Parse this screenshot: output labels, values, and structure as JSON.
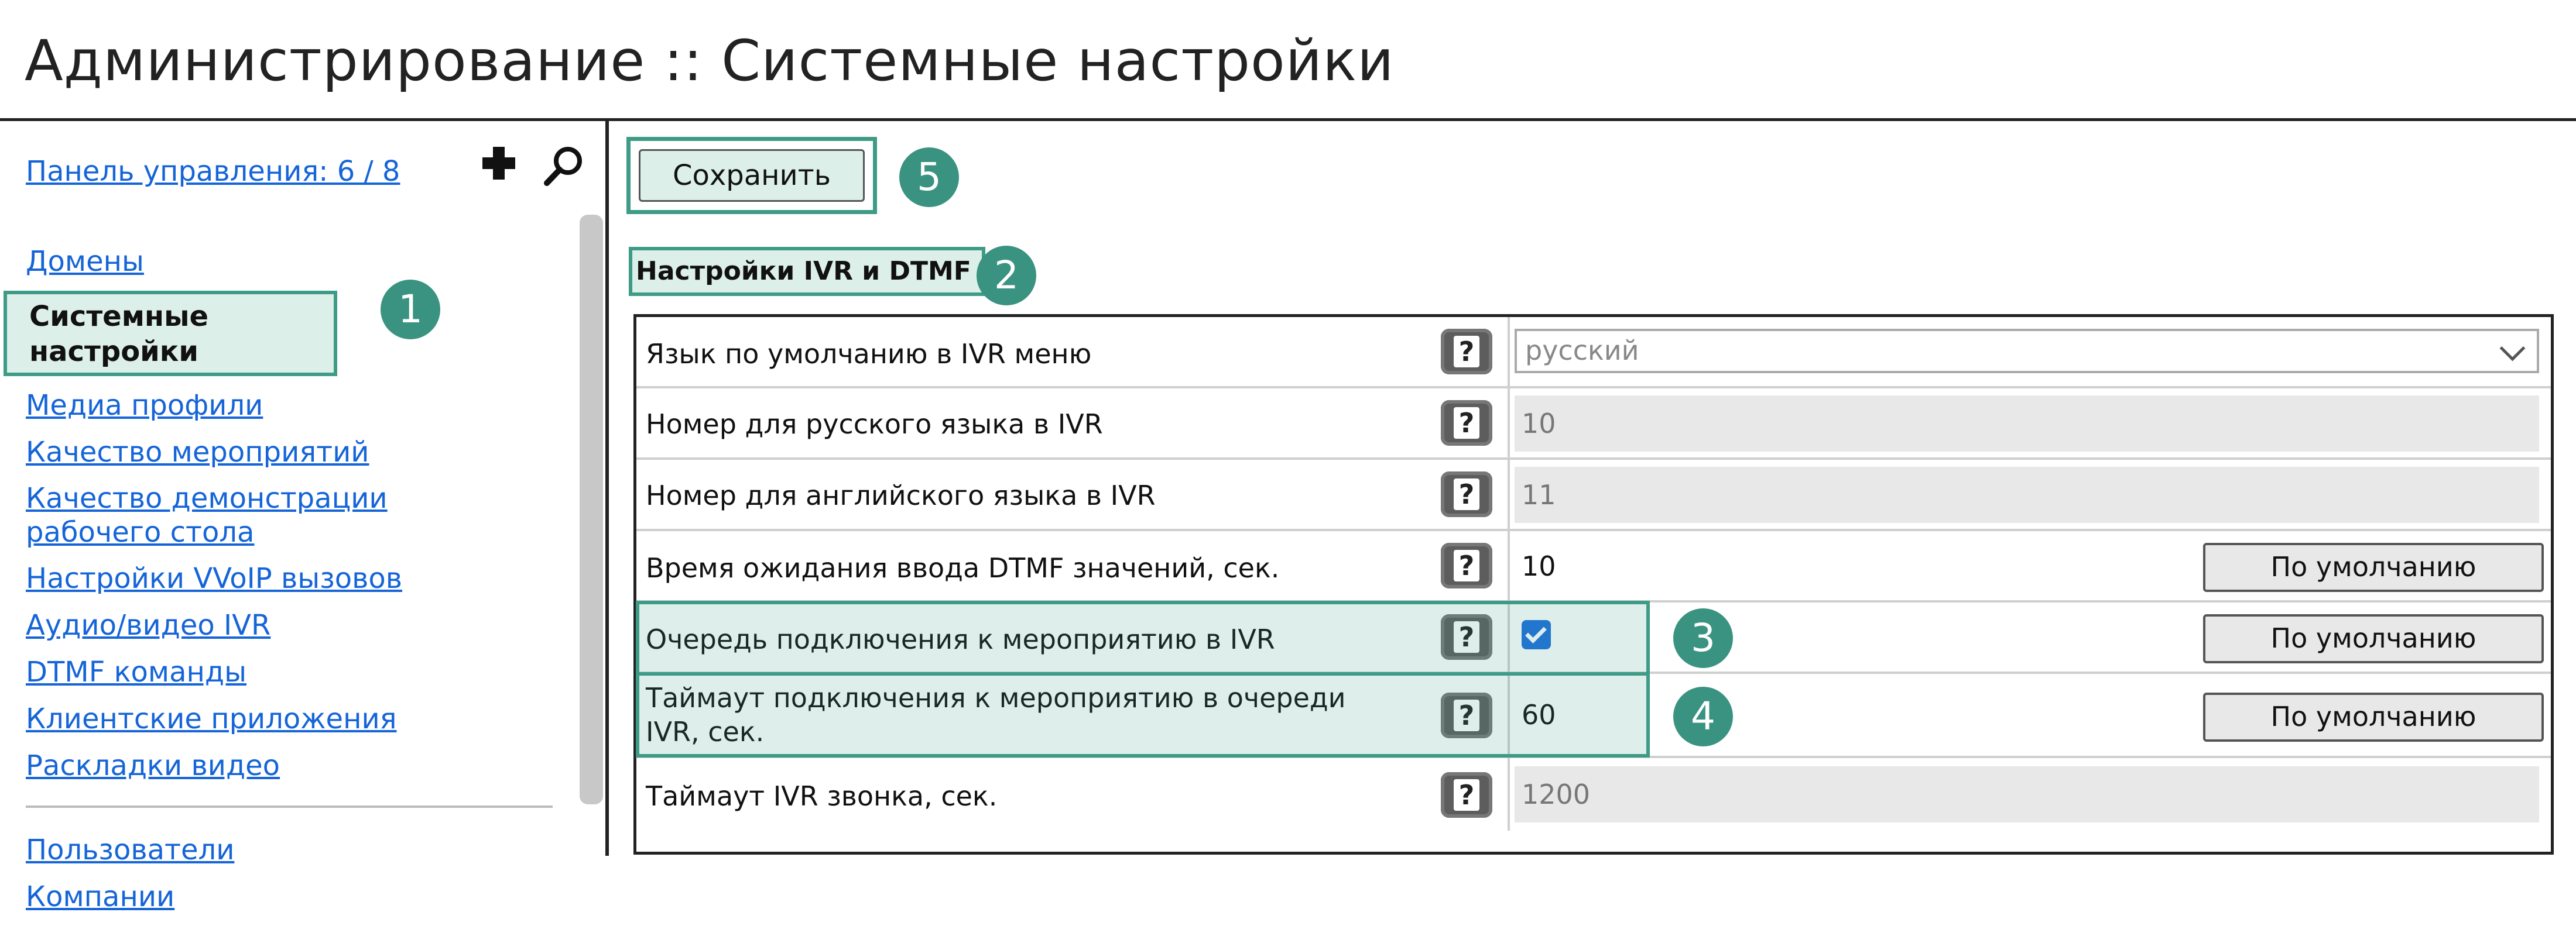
{
  "page_title": "Администрирование :: Системные настройки",
  "sidebar": {
    "panel_link": "Панель управления: 6 / 8",
    "add_icon": "plus-icon",
    "search_icon": "search-icon",
    "items": [
      {
        "label": "Домены",
        "active": false
      },
      {
        "label": "Системные настройки",
        "active": true
      },
      {
        "label": "Медиа профили",
        "active": false
      },
      {
        "label": "Качество мероприятий",
        "active": false
      },
      {
        "label": "Качество демонстрации рабочего стола",
        "active": false
      },
      {
        "label": "Настройки VVoIP вызовов",
        "active": false
      },
      {
        "label": "Аудио/видео IVR",
        "active": false
      },
      {
        "label": "DTMF команды",
        "active": false
      },
      {
        "label": "Клиентские приложения",
        "active": false
      },
      {
        "label": "Раскладки видео",
        "active": false
      }
    ],
    "items_after_divider": [
      {
        "label": "Пользователи"
      },
      {
        "label": "Компании"
      }
    ]
  },
  "toolbar": {
    "save_label": "Сохранить"
  },
  "section": {
    "title": "Настройки IVR и DTMF"
  },
  "settings": [
    {
      "label": "Язык по умолчанию в IVR меню",
      "help": "?",
      "value": "русский",
      "kind": "select"
    },
    {
      "label": "Номер для русского языка в IVR",
      "help": "?",
      "value": "10",
      "kind": "disabled"
    },
    {
      "label": "Номер для английского языка в IVR",
      "help": "?",
      "value": "11",
      "kind": "disabled"
    },
    {
      "label": "Время ожидания ввода DTMF значений, сек.",
      "help": "?",
      "value": "10",
      "kind": "text",
      "default_label": "По умолчанию"
    },
    {
      "label": "Очередь подключения к мероприятию в IVR",
      "help": "?",
      "value": "checked",
      "kind": "checkbox",
      "default_label": "По умолчанию"
    },
    {
      "label": "Таймаут подключения к мероприятию в очереди IVR, сек.",
      "help": "?",
      "value": "60",
      "kind": "text",
      "default_label": "По умолчанию"
    },
    {
      "label": "Таймаут IVR звонка, сек.",
      "help": "?",
      "value": "1200",
      "kind": "disabled"
    }
  ],
  "badges": [
    "1",
    "2",
    "3",
    "4",
    "5"
  ],
  "colors": {
    "accent_green": "#3e9b86",
    "highlight_fill": "#dcefe9",
    "link_blue": "#1565d8",
    "checkbox_blue": "#1e6fdc"
  }
}
